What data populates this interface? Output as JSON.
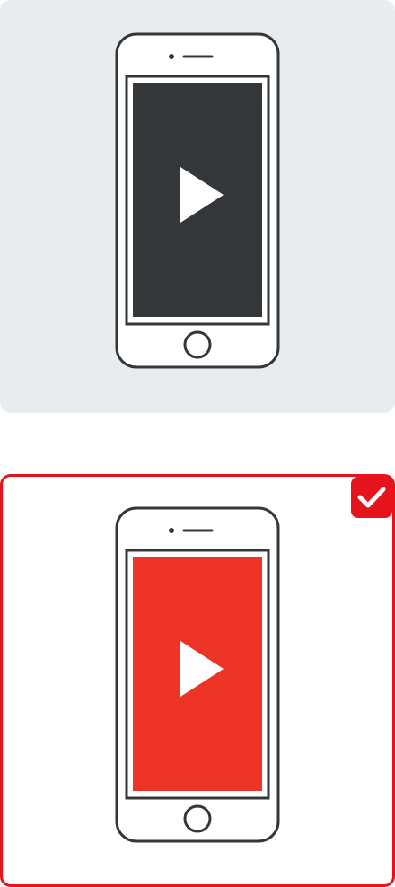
{
  "options": [
    {
      "id": "option-1",
      "selected": false,
      "icon": "phone-video-icon",
      "screen_color": "#33373a"
    },
    {
      "id": "option-2",
      "selected": true,
      "icon": "phone-video-icon",
      "screen_color": "#ee3426",
      "badge_icon": "checkmark-icon"
    }
  ],
  "colors": {
    "card_bg": "#e9ecef",
    "phone_outline": "#33373a",
    "selected_border": "#e6121c",
    "play_icon": "#ffffff"
  }
}
